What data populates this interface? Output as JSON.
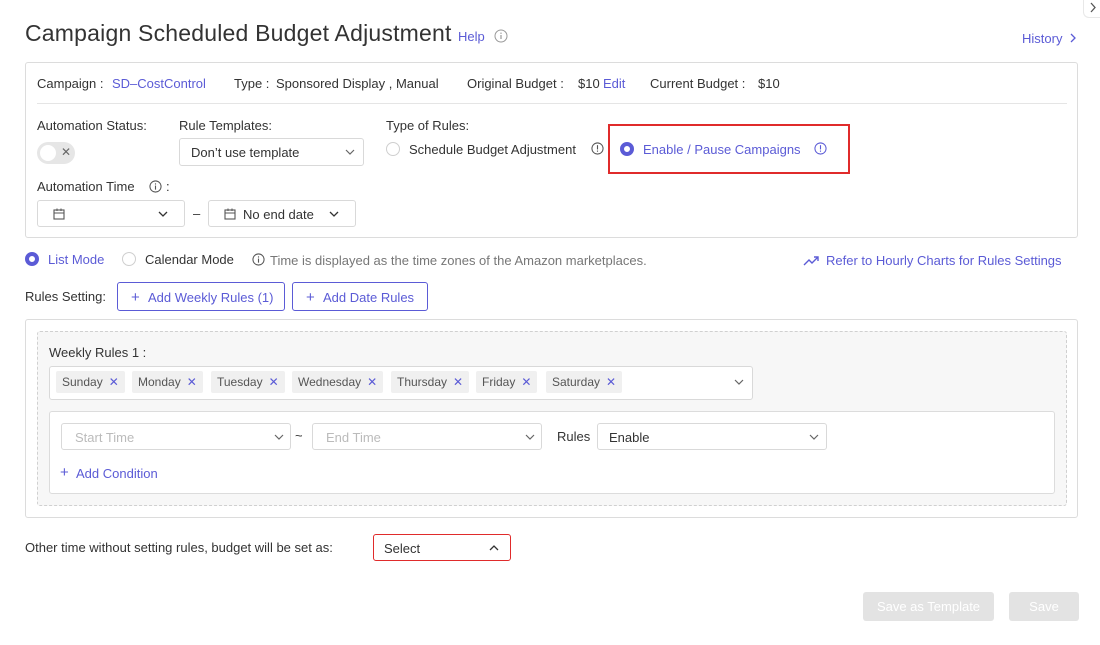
{
  "header": {
    "title": "Campaign Scheduled Budget Adjustment",
    "help_label": "Help",
    "history_label": "History"
  },
  "info": {
    "campaign_label": "Campaign :",
    "campaign_value": "SD–CostControl",
    "type_label": "Type :",
    "type_value": "Sponsored Display , Manual",
    "original_budget_label": "Original Budget :",
    "original_budget_value": "$10",
    "edit_label": "Edit",
    "current_budget_label": "Current Budget :",
    "current_budget_value": "$10"
  },
  "automation_status": {
    "label": "Automation Status:",
    "enabled": false
  },
  "rule_templates": {
    "label": "Rule Templates:",
    "value": "Don’t use template"
  },
  "type_of_rules": {
    "label": "Type of Rules:",
    "options": [
      "Schedule Budget Adjustment",
      "Enable / Pause Campaigns"
    ],
    "selected": "Enable / Pause Campaigns"
  },
  "automation_time": {
    "label": "Automation Time",
    "suffix": ":",
    "start_value": "",
    "separator": "–",
    "end_value": "No end date"
  },
  "mode": {
    "list_mode": "List Mode",
    "calendar_mode": "Calendar Mode",
    "selected": "List Mode",
    "timezone_note": "Time is displayed as the time zones of the Amazon marketplaces.",
    "hourly_charts_link": "Refer to Hourly Charts for Rules Settings"
  },
  "rules_setting": {
    "label": "Rules Setting:",
    "add_weekly": "Add Weekly Rules (1)",
    "add_date": "Add Date Rules"
  },
  "weekly_rules": {
    "title": "Weekly Rules 1 :",
    "days": [
      "Sunday",
      "Monday",
      "Tuesday",
      "Wednesday",
      "Thursday",
      "Friday",
      "Saturday"
    ],
    "start_time_placeholder": "Start Time",
    "tilde": "~",
    "end_time_placeholder": "End Time",
    "rules_label": "Rules",
    "rules_value": "Enable",
    "add_condition": "Add Condition"
  },
  "other_time": {
    "label": "Other time without setting rules, budget will be set as:",
    "select_value": "Select"
  },
  "footer": {
    "save_template": "Save as Template",
    "save": "Save"
  },
  "colors": {
    "accent": "#5b5bd6",
    "highlight_border": "#e02b2b",
    "disabled_button": "#e3e3e3"
  }
}
